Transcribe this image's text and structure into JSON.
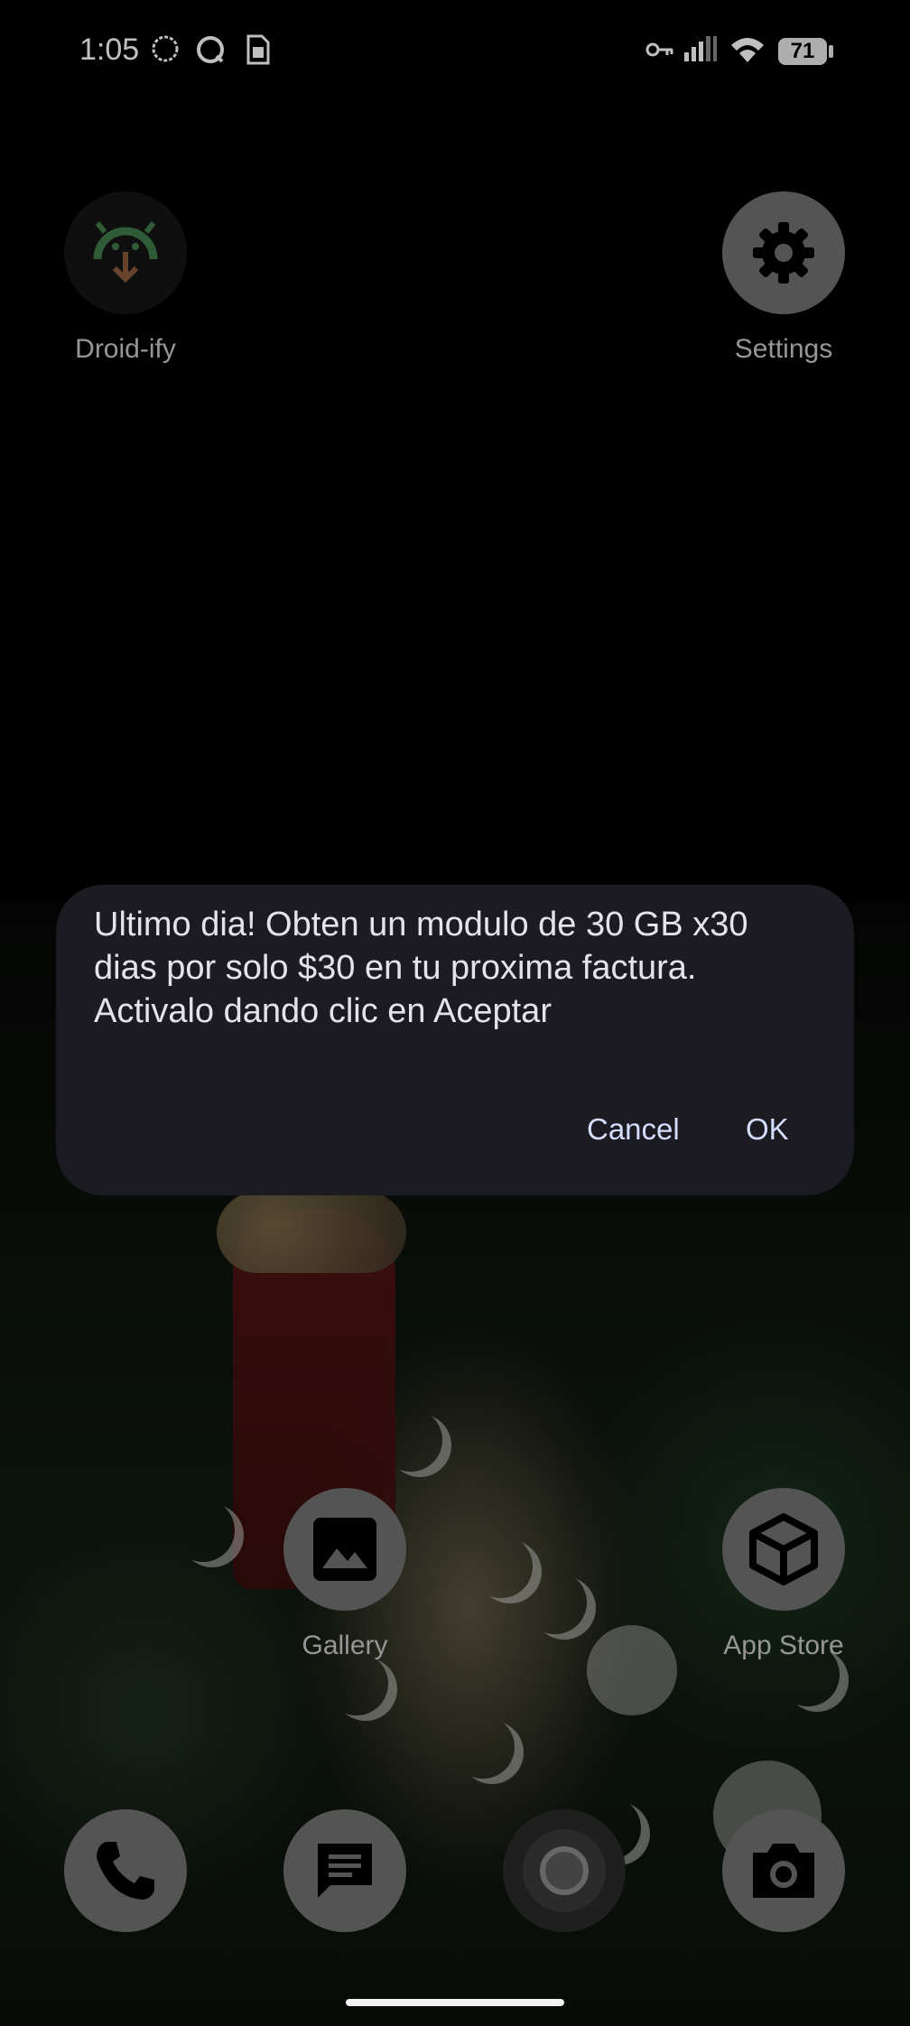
{
  "status_bar": {
    "time": "1:05",
    "battery": "71",
    "left_icons": [
      "chat-bubble-icon",
      "circle-chat-icon",
      "sim-card-icon"
    ],
    "right_icons": [
      "vpn-key-icon",
      "signal-icon",
      "wifi-icon",
      "battery-icon"
    ]
  },
  "apps": {
    "droidify": "Droid-ify",
    "settings": "Settings",
    "gallery": "Gallery",
    "app_store": "App Store"
  },
  "dock": [
    "phone-icon",
    "messages-icon",
    "browser-icon",
    "camera-icon"
  ],
  "dialog": {
    "message": "Ultimo dia! Obten un modulo de 30 GB x30 dias por solo $30 en tu proxima factura. Activalo dando clic en Aceptar",
    "cancel_label": "Cancel",
    "ok_label": "OK"
  },
  "colors": {
    "dialog_bg": "#1b1b21",
    "button_text": "#d4dcff",
    "icon_grey": "#707070"
  }
}
